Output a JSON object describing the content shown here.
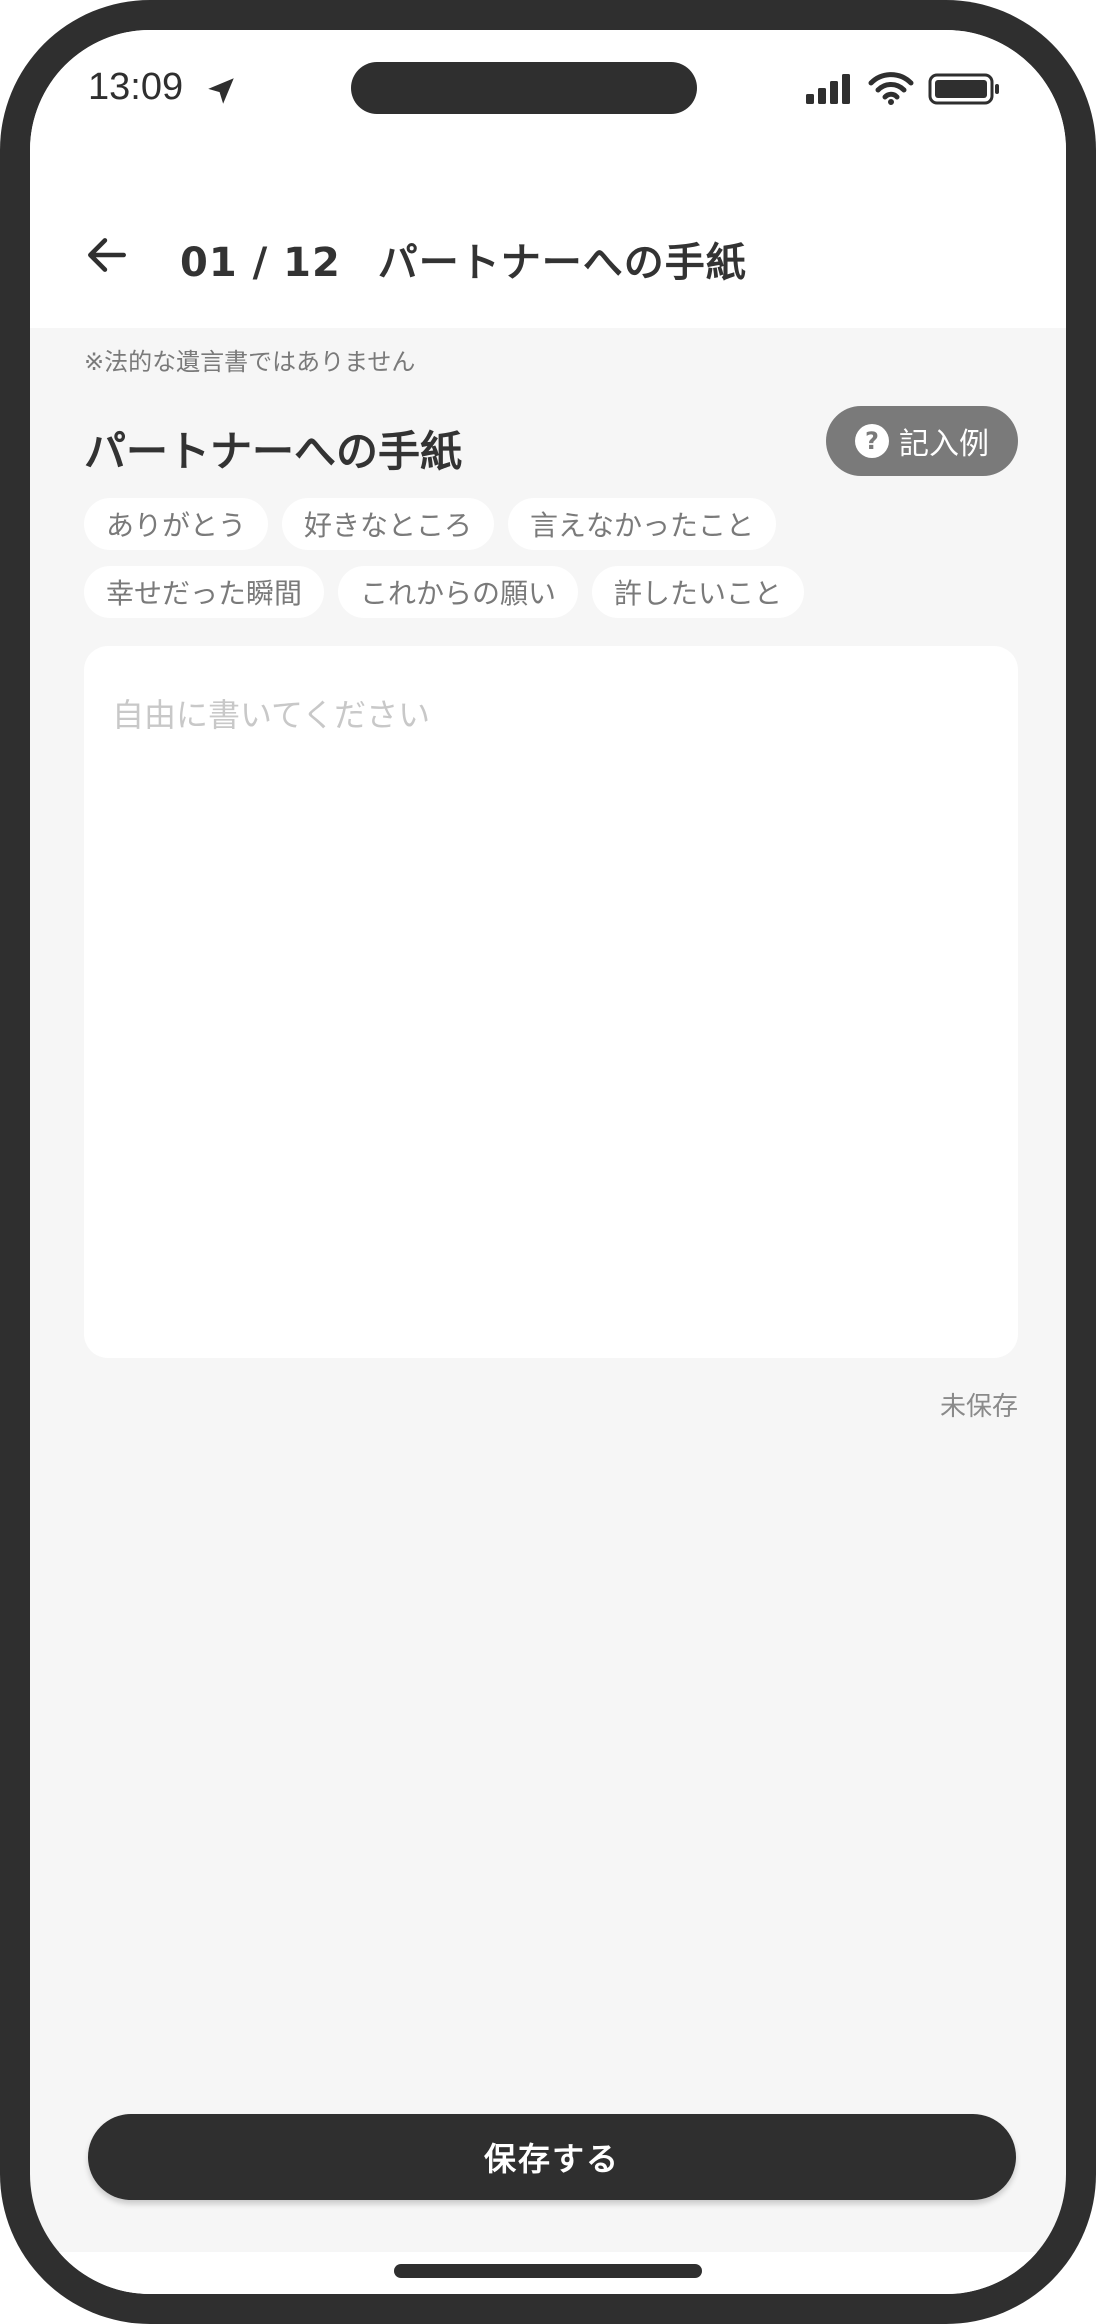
{
  "status_bar": {
    "time": "13:09",
    "icons": [
      "location-arrow-icon",
      "signal-icon",
      "wifi-icon",
      "battery-icon"
    ]
  },
  "nav": {
    "counter": "01 / 12",
    "title": "パートナーへの手紙",
    "back_icon": "arrow-left-icon"
  },
  "main": {
    "disclaimer": "※法的な遺言書ではありません",
    "section_title": "パートナーへの手紙",
    "example_button": "記入例",
    "chips_row1": [
      "ありがとう",
      "好きなところ",
      "言えなかったこと"
    ],
    "chips_row2": [
      "幸せだった瞬間",
      "これからの願い",
      "許したいこと"
    ],
    "textarea": {
      "value": "",
      "placeholder": "自由に書いてください"
    },
    "save_state": "未保存",
    "save_button": "保存する"
  },
  "colors": {
    "frame": "#2f2f2f",
    "background": "#f6f6f6",
    "surface": "#ffffff",
    "primary": "#2f2f2f",
    "muted": "#7a7a7a"
  }
}
